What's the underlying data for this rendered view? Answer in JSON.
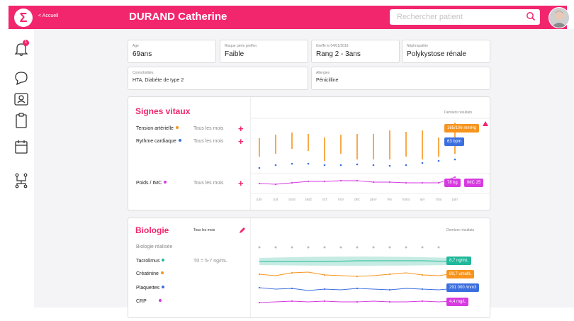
{
  "app": {
    "logo_glyph": "Σ",
    "breadcrumb": "< Accueil",
    "patient_name": "DURAND Catherine"
  },
  "search": {
    "placeholder": "Rechercher patient"
  },
  "sidebar": {
    "notif_count": "1"
  },
  "info": {
    "age": {
      "label": "Age",
      "value": "69ans"
    },
    "risk": {
      "label": "Risque perte greffon",
      "value": "Faible"
    },
    "graft": {
      "label": "Greffé le 04/01/2018",
      "value": "Rang 2 - 3ans"
    },
    "nephro": {
      "label": "Néphropathie",
      "value": "Polykystose rénale"
    },
    "comorb": {
      "label": "Comorbidités",
      "value": "HTA, Diabète de type 2"
    },
    "allergy": {
      "label": "Allergies",
      "value": "Pénicilline"
    }
  },
  "vitals": {
    "title": "Signes vitaux",
    "last_results": "Derniers résultats",
    "rows": [
      {
        "label": "Tension artérielle",
        "freq": "Tous les mois",
        "color": "#f7941d"
      },
      {
        "label": "Rythme cardiaque",
        "freq": "Tous les mois",
        "color": "#3b6fe0"
      },
      {
        "label": "Poids / IMC",
        "freq": "Tous les mois",
        "color": "#d63ae0"
      }
    ],
    "tags": {
      "bp": "165/106 mmHg",
      "hr": "63 bpm",
      "weight": "78 kg",
      "bmi": "IMC 25"
    },
    "months": [
      "juin",
      "juil",
      "aout",
      "sept",
      "oct",
      "nov",
      "dec",
      "janv",
      "fev",
      "mars",
      "avr",
      "mai",
      "juin"
    ]
  },
  "bio": {
    "title": "Biologie",
    "freq": "Tous les mois",
    "last_results": "Derniers résultats",
    "done_label": "Biologie réalisée",
    "rows": [
      {
        "label": "Tacrolimus",
        "range": "T0 = 5-7 ng/mL",
        "color": "#1fb89a"
      },
      {
        "label": "Créatinine",
        "range": "",
        "color": "#f7941d"
      },
      {
        "label": "Plaquettes",
        "range": "",
        "color": "#3b6fe0"
      },
      {
        "label": "CRP",
        "range": "",
        "color": "#d63ae0"
      }
    ],
    "tags": {
      "tacro": "8,7 ng/mL",
      "creat": "89,7 umol/L",
      "plaq": "291 000 /mm3",
      "crp": "4,4 mg/L"
    }
  },
  "colors": {
    "accent": "#f2266d",
    "orange": "#f7941d",
    "blue": "#3b6fe0",
    "magenta": "#d63ae0",
    "teal": "#1fb89a"
  }
}
